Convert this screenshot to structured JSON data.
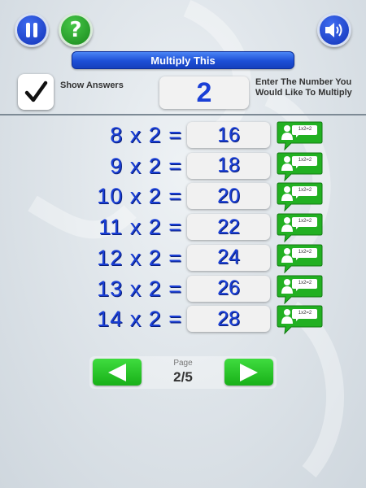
{
  "header": {
    "title": "Multiply This",
    "pause_icon": "pause-icon",
    "help_icon": "help-icon",
    "help_glyph": "?",
    "sound_icon": "speaker-icon"
  },
  "controls": {
    "show_answers_label": "Show Answers",
    "show_answers_checked": true,
    "number_value": "2",
    "enter_label": "Enter The Number You Would Like To Multiply"
  },
  "rows": [
    {
      "equation": "8 x 2 =",
      "answer": "16",
      "hint": "1x2=2"
    },
    {
      "equation": "9 x 2 =",
      "answer": "18",
      "hint": "1x2=2"
    },
    {
      "equation": "10 x 2 =",
      "answer": "20",
      "hint": "1x2=2"
    },
    {
      "equation": "11 x 2 =",
      "answer": "22",
      "hint": "1x2=2"
    },
    {
      "equation": "12 x 2 =",
      "answer": "24",
      "hint": "1x2=2"
    },
    {
      "equation": "13 x 2 =",
      "answer": "26",
      "hint": "1x2=2"
    },
    {
      "equation": "14 x 2 =",
      "answer": "28",
      "hint": "1x2=2"
    }
  ],
  "pager": {
    "label": "Page",
    "value": "2/5"
  },
  "colors": {
    "accent_blue": "#1a3fd6",
    "accent_green": "#2bbf2b"
  }
}
